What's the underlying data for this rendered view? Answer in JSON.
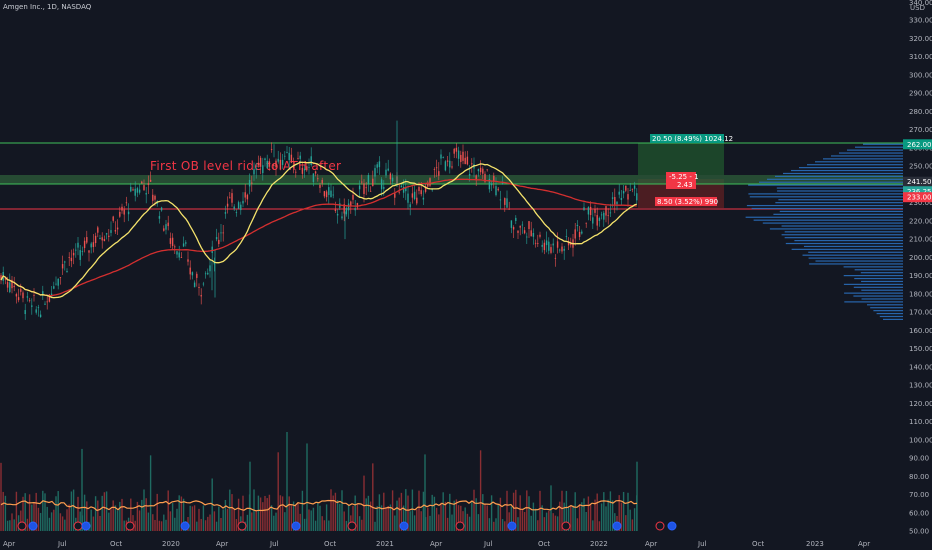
{
  "header": {
    "symbol_title": "Amgen Inc., 1D, NASDAQ",
    "currency": "USD"
  },
  "annotation": {
    "text": "First OB level ride to ATH after"
  },
  "price_scale": {
    "ticks": [
      "340.00",
      "330.00",
      "320.00",
      "310.00",
      "300.00",
      "290.00",
      "280.00",
      "270.00",
      "260.00",
      "250.00",
      "240.00",
      "230.00",
      "220.00",
      "210.00",
      "200.00",
      "190.00",
      "180.00",
      "170.00",
      "160.00",
      "150.00",
      "140.00",
      "130.00",
      "120.00",
      "110.00",
      "100.00",
      "90.00",
      "80.00",
      "70.00",
      "60.00",
      "50.00"
    ],
    "badges": [
      {
        "label": "262.00",
        "color": "#089981",
        "value": 262
      },
      {
        "label": "241.50",
        "color": "#2a2e39",
        "value": 241.5
      },
      {
        "label": "236.25",
        "color": "#26a69a",
        "value": 236.25
      },
      {
        "label": "233.00",
        "color": "#f23645",
        "value": 233
      }
    ]
  },
  "time_axis": {
    "labels": [
      "Apr",
      "Jul",
      "Oct",
      "2020",
      "Apr",
      "Jul",
      "Oct",
      "2021",
      "Apr",
      "Jul",
      "Oct",
      "2022",
      "Apr",
      "Jul",
      "Oct",
      "2023",
      "Apr"
    ]
  },
  "position_tool": {
    "target_label": "20.50 (8.49%) 1024.12",
    "entry_label_line1": "-5.25 - 1",
    "entry_label_line2": "2.43",
    "stop_label": "8.50 (3.52%) 990",
    "target_color": "#089981",
    "stop_color": "#f23645"
  },
  "levels": {
    "green_top": 262,
    "green_zone_top": 245,
    "green_zone_bottom": 241.5,
    "red_level": 233
  },
  "colors": {
    "background": "#131722",
    "ma_fast": "#f5e36c",
    "ma_slow": "#d32f2f",
    "volume_ma": "#ff9e4f",
    "profile": "#2a6ebb"
  },
  "chart_data": {
    "type": "candlestick",
    "title": "Amgen Inc., 1D, NASDAQ",
    "y_unit": "USD",
    "ylim": [
      50,
      340
    ],
    "x_range": [
      "2019-04",
      "2023-05"
    ],
    "key_price_levels": [
      262,
      241.5,
      236.25,
      233
    ],
    "price_path_approx": [
      {
        "date": "2019-04",
        "close": 190
      },
      {
        "date": "2019-06",
        "close": 172
      },
      {
        "date": "2019-08",
        "close": 200
      },
      {
        "date": "2019-10",
        "close": 215
      },
      {
        "date": "2019-12",
        "close": 240
      },
      {
        "date": "2020-02",
        "close": 205
      },
      {
        "date": "2020-03",
        "close": 185
      },
      {
        "date": "2020-05",
        "close": 230
      },
      {
        "date": "2020-07",
        "close": 255
      },
      {
        "date": "2020-09",
        "close": 250
      },
      {
        "date": "2020-11",
        "close": 225
      },
      {
        "date": "2021-01",
        "close": 245
      },
      {
        "date": "2021-03",
        "close": 232
      },
      {
        "date": "2021-05",
        "close": 255
      },
      {
        "date": "2021-07",
        "close": 245
      },
      {
        "date": "2021-09",
        "close": 215
      },
      {
        "date": "2021-11",
        "close": 205
      },
      {
        "date": "2022-01",
        "close": 225
      },
      {
        "date": "2022-03",
        "close": 236
      }
    ]
  },
  "icons": {
    "event_badges": [
      "dividend-icon",
      "earnings-icon"
    ]
  }
}
